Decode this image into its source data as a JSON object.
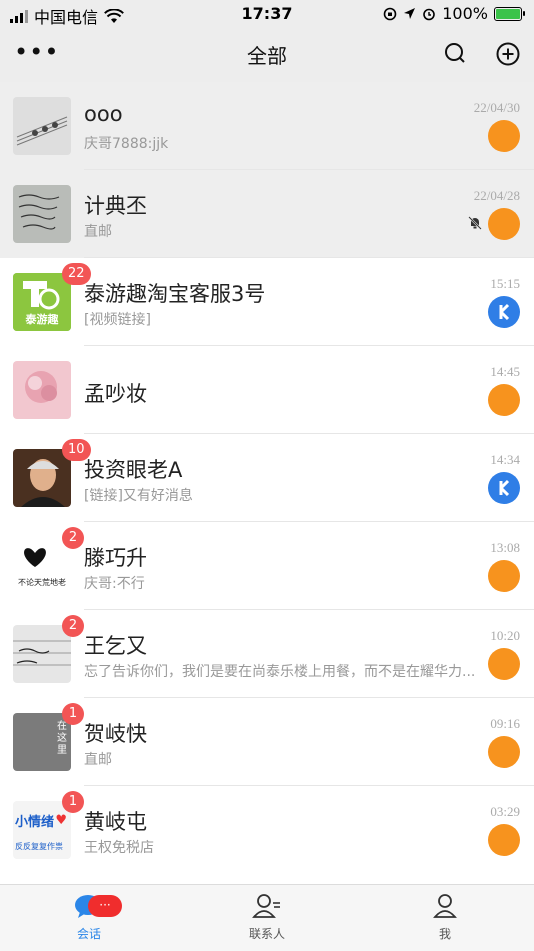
{
  "status": {
    "carrier": "中国电信",
    "time": "17:37",
    "battery": "100%",
    "battery_level": 1.0
  },
  "header": {
    "title": "全部",
    "more_icon": "more-icon",
    "search_icon": "search-icon",
    "add_icon": "add-icon"
  },
  "conversations": [
    {
      "name": "ooo",
      "message": "庆哥7888:jjk",
      "time": "22/04/30",
      "badge": "",
      "pinned": true,
      "muted": false,
      "app": "orange"
    },
    {
      "name": "计典丕",
      "message": "直邮",
      "time": "22/04/28",
      "badge": "",
      "pinned": true,
      "muted": true,
      "app": "orange"
    },
    {
      "name": "泰游趣淘宝客服3号",
      "message": "[视频链接]",
      "time": "15:15",
      "badge": "22",
      "pinned": false,
      "muted": false,
      "app": "blue"
    },
    {
      "name": "孟吵妆",
      "message": "",
      "time": "14:45",
      "badge": "",
      "pinned": false,
      "muted": false,
      "app": "orange"
    },
    {
      "name": "投资眼老A",
      "message": "[链接]又有好消息",
      "time": "14:34",
      "badge": "10",
      "pinned": false,
      "muted": false,
      "app": "blue"
    },
    {
      "name": "滕巧升",
      "message": "庆哥:不行",
      "time": "13:08",
      "badge": "2",
      "pinned": false,
      "muted": false,
      "app": "orange"
    },
    {
      "name": "王乞又",
      "message": "忘了告诉你们，我们是要在尚泰乐楼上用餐，而不是在耀华力...",
      "time": "10:20",
      "badge": "2",
      "pinned": false,
      "muted": false,
      "app": "orange"
    },
    {
      "name": "贺岐快",
      "message": "直邮",
      "time": "09:16",
      "badge": "1",
      "pinned": false,
      "muted": false,
      "app": "orange"
    },
    {
      "name": "黄岐屯",
      "message": "王权免税店",
      "time": "03:29",
      "badge": "1",
      "pinned": false,
      "muted": false,
      "app": "orange"
    }
  ],
  "avatar_texts": {
    "tyq_logo": "泰游趣",
    "heart_caption": "不论天荒地老",
    "here_text": "在这里",
    "mood_title": "小情绪",
    "mood_sub": "反反复复作祟"
  },
  "tabbar": {
    "tabs": [
      {
        "label": "会话",
        "icon": "chat-icon",
        "active": true
      },
      {
        "label": "联系人",
        "icon": "contacts-icon",
        "active": false
      },
      {
        "label": "我",
        "icon": "profile-icon",
        "active": false
      }
    ],
    "chat_badge": "···"
  },
  "colors": {
    "accent": "#2b86e8",
    "badge": "#f25555",
    "app_orange": "#f7931e",
    "app_blue": "#2f7ee6"
  }
}
